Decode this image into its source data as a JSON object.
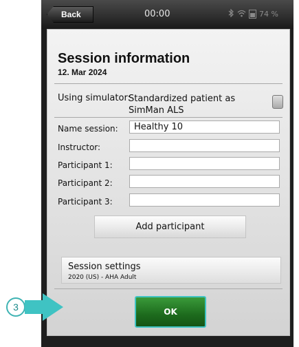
{
  "status_bar": {
    "back_label": "Back",
    "time": "00:00",
    "battery_percent": "74 %",
    "icons": [
      "bluetooth-icon",
      "wifi-icon",
      "battery-icon"
    ]
  },
  "session": {
    "title": "Session information",
    "date": "12. Mar 2024",
    "simulator_label": "Using simulator:",
    "simulator_value": "Standardized patient as SimMan ALS",
    "simulator_checked": false
  },
  "form": {
    "rows": [
      {
        "label": "Name session:",
        "value": "Healthy 10"
      },
      {
        "label": "Instructor:",
        "value": ""
      },
      {
        "label": "Participant 1:",
        "value": ""
      },
      {
        "label": "Participant 2:",
        "value": ""
      },
      {
        "label": "Participant 3:",
        "value": ""
      }
    ],
    "add_participant_label": "Add participant"
  },
  "settings": {
    "title": "Session settings",
    "subtitle": "2020 (US) - AHA Adult"
  },
  "ok_label": "OK",
  "annotation": {
    "step_number": "3",
    "color": "#3fc3c3"
  }
}
